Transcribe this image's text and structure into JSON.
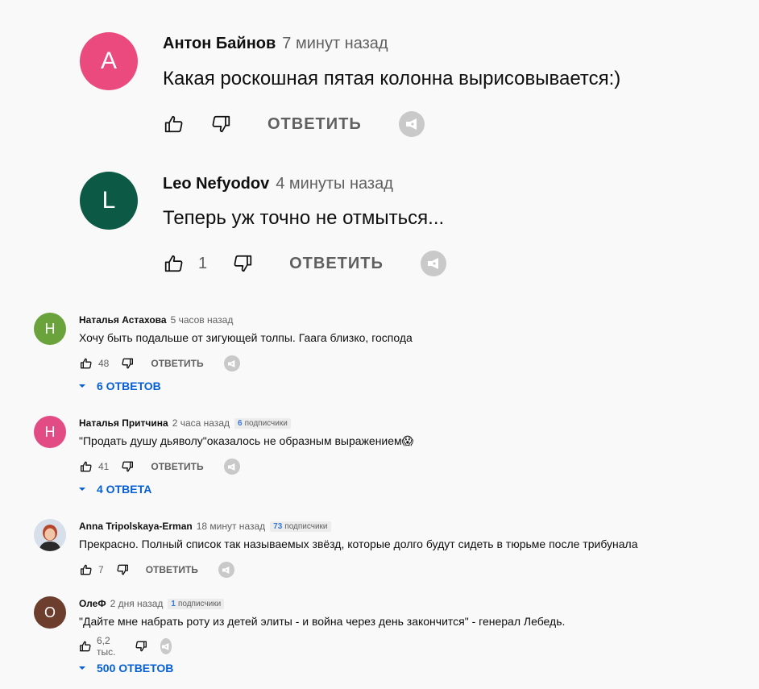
{
  "labels": {
    "reply": "ОТВЕТИТЬ"
  },
  "colors": {
    "avatar_a": "#ea4a7e",
    "avatar_leo": "#0c5a46",
    "avatar_n1": "#6aa23b",
    "avatar_n2": "#e24b83",
    "avatar_o": "#6d3d2e",
    "link": "#065fd4"
  },
  "comments": [
    {
      "avatar_letter": "А",
      "author": "Антон Байнов",
      "time": "7 минут назад",
      "text": "Какая роскошная пятая колонна вырисовывается:)",
      "likes": ""
    },
    {
      "avatar_letter": "L",
      "author": "Leo Nefyodov",
      "time": "4 минуты назад",
      "text": "Теперь уж точно не отмыться...",
      "likes": "1"
    },
    {
      "avatar_letter": "Н",
      "author": "Наталья Астахова",
      "time": "5 часов назад",
      "text": "Хочу быть подальше от зигующей толпы. Гаага близко,  господа",
      "likes": "48",
      "replies": "6 ОТВЕТОВ"
    },
    {
      "avatar_letter": "Н",
      "author": "Наталья Притчина",
      "time": "2 часа назад",
      "subs_count": "6",
      "subs_label": "подписчики",
      "text": "\"Продать душу дьяволу\"оказалось не образным выражением😱",
      "likes": "41",
      "replies": "4 ОТВЕТА"
    },
    {
      "author": "Anna Tripolskaya-Erman",
      "time": "18 минут назад",
      "subs_count": "73",
      "subs_label": "подписчики",
      "text": "Прекрасно. Полный список так называемых звёзд, которые долго будут сидеть в тюрьме после трибунала",
      "likes": "7"
    },
    {
      "avatar_letter": "О",
      "author": "ОлеФ",
      "time": "2 дня назад",
      "subs_count": "1",
      "subs_label": "подписчики",
      "text": "\"Дайте мне набрать роту из детей элиты - и война через день закончится\" - генерал Лебедь.",
      "likes": "6,2 тыс.",
      "replies": "500 ОТВЕТОВ"
    }
  ]
}
